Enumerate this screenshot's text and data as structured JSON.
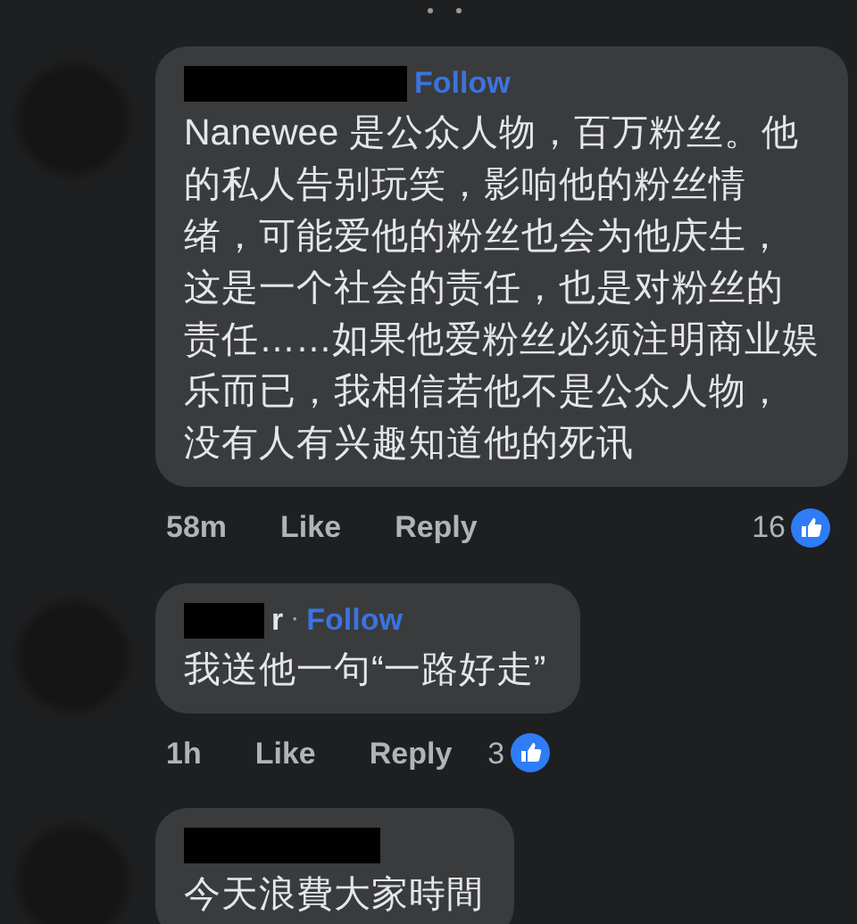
{
  "comments": [
    {
      "redacted": true,
      "follow": "Follow",
      "text": "Nanewee 是公众人物，百万粉丝。他的私人告别玩笑，影响他的粉丝情绪，可能爱他的粉丝也会为他庆生，这是一个社会的责任，也是对粉丝的责任……如果他爱粉丝必须注明商业娱乐而已，我相信若他不是公众人物，没有人有兴趣知道他的死讯",
      "time": "58m",
      "like": "Like",
      "reply": "Reply",
      "reactions": "16"
    },
    {
      "author": "r",
      "redacted": true,
      "separator": "·",
      "follow": "Follow",
      "text": "我送他一句“一路好走”",
      "time": "1h",
      "like": "Like",
      "reply": "Reply",
      "reactions": "3"
    },
    {
      "redacted": true,
      "text": "今天浪費大家時間"
    }
  ]
}
